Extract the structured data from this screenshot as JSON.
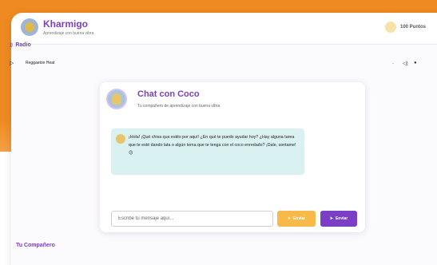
{
  "header": {
    "title": "Kharmigo",
    "subtitle": "Aprendizaje con buena vibra",
    "points": "100 Puntos"
  },
  "radio": {
    "title": "Radio",
    "track": "Reggaeton Heat"
  },
  "chat": {
    "title": "Chat con Coco",
    "subtitle": "Tu compañero de aprendizaje con buena vibra",
    "message": "¡Hola! ¡Qué chiva que estés por aquí! ¿En qué te puedo ayudar hoy? ¿Hay alguna tarea que te esté dando lata o algún tema que te tenga con el coco enredado? ¡Dale, contame! 😉",
    "input_placeholder": "Escribe tu mensaje aquí...",
    "secondary_button": "Enviar",
    "send_button": "Enviar"
  },
  "companion": {
    "title": "Tu Compañero"
  },
  "colors": {
    "accent": "#7a3fc4",
    "background": "#ef8a22",
    "bubble": "#d9f1f0",
    "yellow_button": "#f6b94a"
  },
  "icons": {
    "radio": "radio-icon",
    "play": "play-icon",
    "volume": "volume-icon",
    "coin": "coin-icon",
    "send": "send-icon"
  }
}
